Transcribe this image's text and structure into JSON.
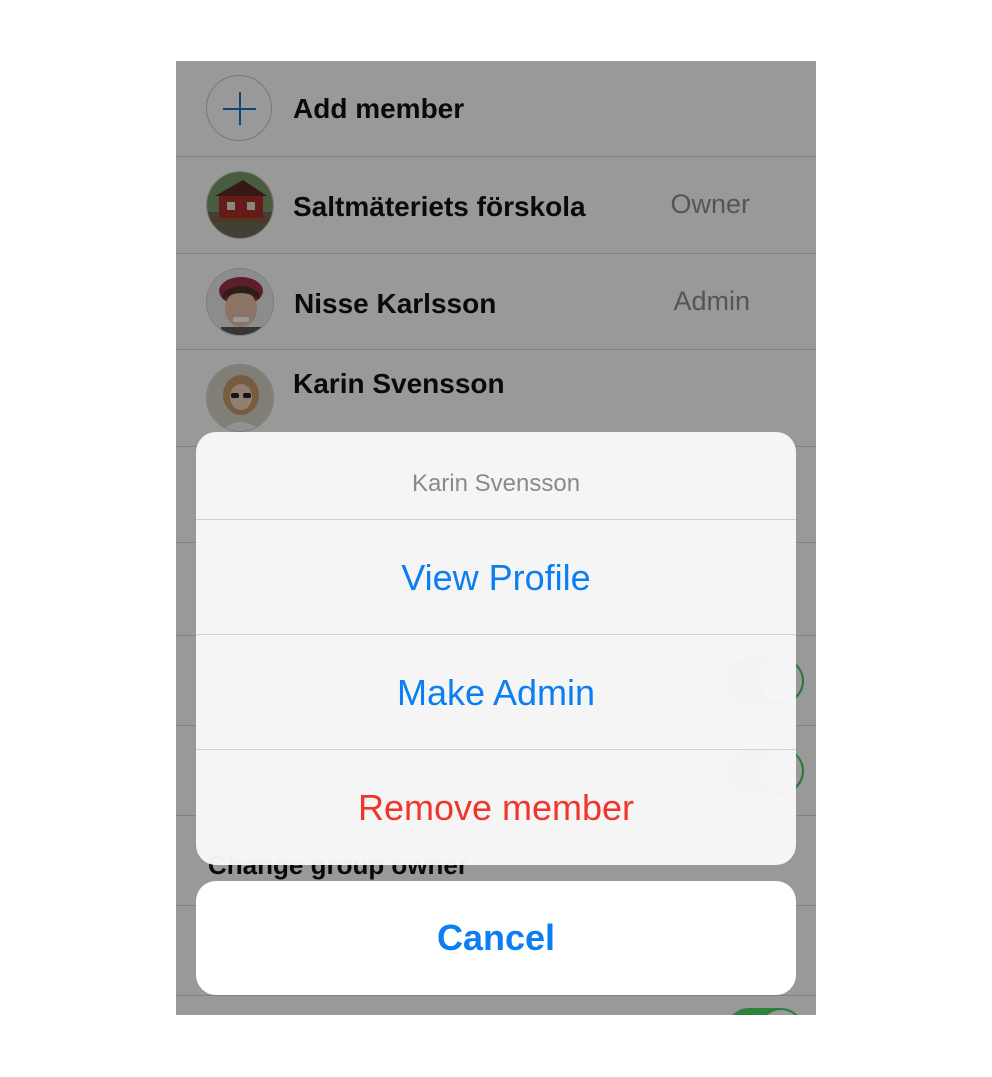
{
  "members_list": {
    "add_member_label": "Add member",
    "members": [
      {
        "name": "Saltmäteriets förskola",
        "role": "Owner",
        "avatar": "preschool-photo"
      },
      {
        "name": "Nisse Karlsson",
        "role": "Admin",
        "avatar": "person-photo"
      },
      {
        "name": "Karin Svensson",
        "role": "",
        "avatar": "person-photo"
      }
    ],
    "change_owner_label": "Change group owner",
    "toggle_color": "#4cd964"
  },
  "action_sheet": {
    "title": "Karin Svensson",
    "actions": [
      {
        "label": "View Profile",
        "color": "#0b7ef2"
      },
      {
        "label": "Make Admin",
        "color": "#0b7ef2"
      },
      {
        "label": "Remove member",
        "color": "#f0352c"
      }
    ],
    "cancel_label": "Cancel"
  }
}
